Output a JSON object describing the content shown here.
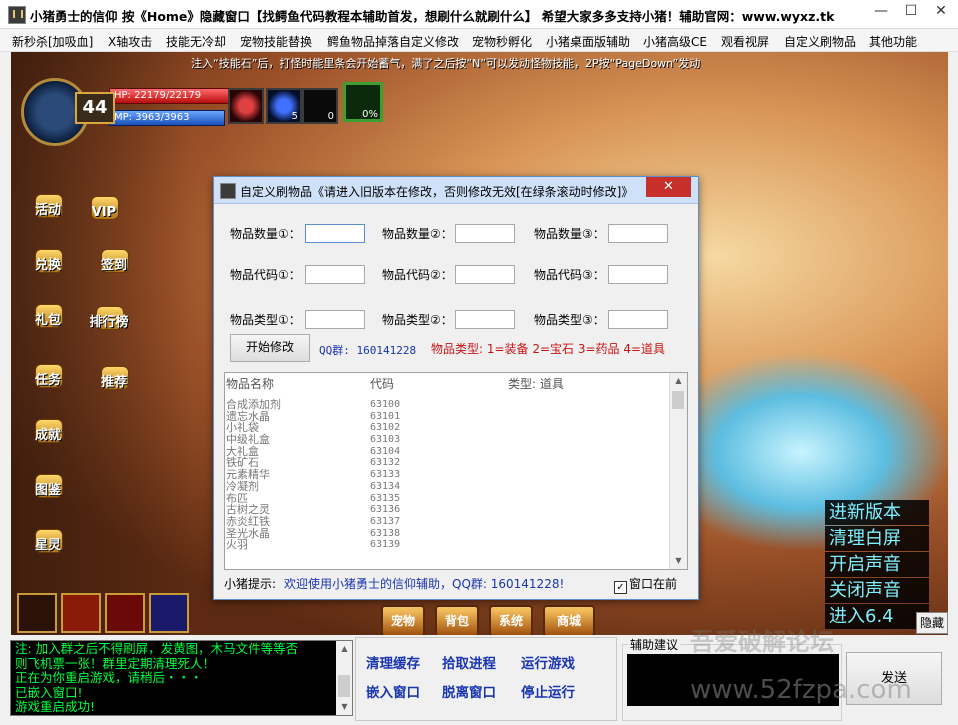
{
  "window": {
    "title": "小猪勇士的信仰 按《Home》隐藏窗口【找鳄鱼代码教程本辅助首发，想刷什么就刷什么】 希望大家多多支持小猪！辅助官网：www.wyxz.tk",
    "min_label": "—",
    "max_label": "☐",
    "close_label": "✕"
  },
  "menu": [
    "新秒杀[加吸血]",
    "X轴攻击",
    "技能无冷却",
    "宠物技能替换",
    "鳄鱼物品掉落自定义修改",
    "宠物秒孵化",
    "小猪桌面版辅助",
    "小猪高级CE",
    "观看视屏",
    "自定义刷物品",
    "其他功能"
  ],
  "game": {
    "notice": "注入“技能石”后，打怪时能里条会开始蓄气，满了之后按“N”可以发动怪物技能，2P按“PageDown”发动",
    "level": "44",
    "hp": "HP: 22179/22179",
    "mp": "MP: 3963/3963",
    "slot_counts": [
      "",
      "5",
      "0"
    ],
    "slot_percent": "0%",
    "side_icons": [
      "活动",
      "VIP",
      "兑换",
      "签到",
      "礼包",
      "排行榜",
      "任务",
      "推荐",
      "成就",
      "图鉴",
      "星灵"
    ],
    "bottom_buttons": [
      "宠物",
      "背包",
      "系统",
      "商城"
    ],
    "side_panel": [
      "进新版本",
      "清理白屏",
      "开启声音",
      "关闭声音",
      "进入6.4"
    ],
    "hide_label": "隐藏"
  },
  "dialog": {
    "title": "自定义刷物品《请进入旧版本在修改，否则修改无效[在绿条滚动时修改]》",
    "close_label": "✕",
    "fields": {
      "qty": [
        "物品数量①：",
        "物品数量②：",
        "物品数量③："
      ],
      "code": [
        "物品代码①：",
        "物品代码②：",
        "物品代码③："
      ],
      "type": [
        "物品类型①：",
        "物品类型②：",
        "物品类型③："
      ]
    },
    "start_button": "开始修改",
    "qq_group": "QQ群: 160141228",
    "type_legend": "物品类型: 1=装备   2=宝石   3=药品   4=道具",
    "list": {
      "col_name": "物品名称",
      "col_code": "代码",
      "col_type": "类型: 道具",
      "rows": [
        {
          "name": "合成添加剂",
          "code": "63100"
        },
        {
          "name": "遗忘水晶",
          "code": "63101"
        },
        {
          "name": "小礼袋",
          "code": "63102"
        },
        {
          "name": "中级礼盒",
          "code": "63103"
        },
        {
          "name": "大礼盒",
          "code": "63104"
        },
        {
          "name": "铁矿石",
          "code": "63132"
        },
        {
          "name": "元素精华",
          "code": "63133"
        },
        {
          "name": "冷凝剂",
          "code": "63134"
        },
        {
          "name": "布匹",
          "code": "63135"
        },
        {
          "name": "古树之灵",
          "code": "63136"
        },
        {
          "name": "赤炎红铁",
          "code": "63137"
        },
        {
          "name": "圣光水晶",
          "code": "63138"
        },
        {
          "name": "火羽",
          "code": "63139"
        }
      ]
    },
    "status_prefix": "小猪提示:",
    "status_msg": "欢迎使用小猪勇士的信仰辅助，QQ群: 160141228!",
    "window_on_top_label": "窗口在前",
    "window_on_top_checked": "✓"
  },
  "log": [
    "注: 加入群之后不得刷屏，发黄图，木马文件等等否",
    "则飞机票一张！群里定期清理死人！",
    "正在为你重启游戏，请稍后・・・",
    "已嵌入窗口!",
    "游戏重启成功!"
  ],
  "controls": {
    "clear_cache": "清理缓存",
    "pick_process": "拾取进程",
    "run_game": "运行游戏",
    "embed_window": "嵌入窗口",
    "detach_window": "脱离窗口",
    "stop_running": "停止运行"
  },
  "suggest": {
    "label": "辅助建议",
    "send": "发送"
  },
  "watermark": {
    "forum": "吾爱破解论坛",
    "url": "www.52fzpa.com"
  },
  "icons": [
    "minimize-icon",
    "maximize-icon",
    "close-icon",
    "app-icon",
    "checkbox-icon",
    "scroll-up-icon",
    "scroll-down-icon"
  ]
}
